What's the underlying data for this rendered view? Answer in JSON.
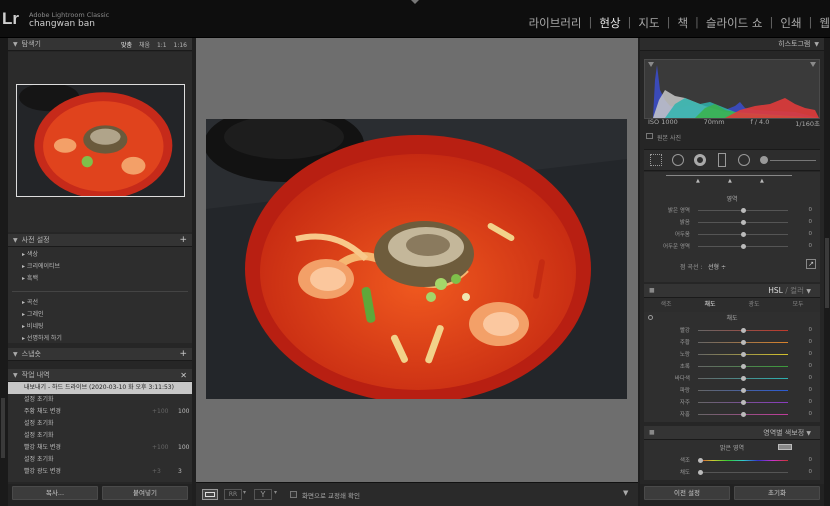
{
  "app": {
    "logo": "Lr",
    "product": "Adobe Lightroom Classic",
    "user": "changwan ban"
  },
  "modules": [
    {
      "label": "라이브러리",
      "active": false
    },
    {
      "label": "현상",
      "active": true
    },
    {
      "label": "지도",
      "active": false
    },
    {
      "label": "책",
      "active": false
    },
    {
      "label": "슬라이드 쇼",
      "active": false
    },
    {
      "label": "인쇄",
      "active": false
    },
    {
      "label": "웹",
      "active": false
    }
  ],
  "navigator": {
    "title": "탐색기",
    "fit": "맞춤",
    "fill": "채움",
    "z1": "1:1",
    "z2": "1:16"
  },
  "presets": {
    "title": "사전 설정",
    "items": [
      "색상",
      "크리에이티브",
      "흑백",
      "곡선",
      "그레인",
      "비네팅",
      "선명하게 하기"
    ]
  },
  "snapshots": {
    "title": "스냅숏"
  },
  "history": {
    "title": "작업 내역",
    "items": [
      {
        "label": "내보내기 - 하드 드라이브 (2020-03-10 화 오후 3:11:53)",
        "a": "",
        "b": "",
        "selected": true
      },
      {
        "label": "설정 초기화",
        "a": "",
        "b": ""
      },
      {
        "label": "주황 채도 변경",
        "a": "+100",
        "b": "100"
      },
      {
        "label": "설정 초기화",
        "a": "",
        "b": ""
      },
      {
        "label": "설정 초기화",
        "a": "",
        "b": ""
      },
      {
        "label": "빨강 채도 변경",
        "a": "+100",
        "b": "100"
      },
      {
        "label": "설정 초기화",
        "a": "",
        "b": ""
      },
      {
        "label": "빨강 광도 변경",
        "a": "+3",
        "b": "3"
      }
    ]
  },
  "left_buttons": {
    "copy": "복사...",
    "paste": "붙여넣기"
  },
  "histogram": {
    "title": "히스토그램",
    "iso": "ISO 1000",
    "focal": "70mm",
    "aperture": "f / 4.0",
    "shutter": "1/160초",
    "original": "원본 사진"
  },
  "tone": {
    "group": "영역",
    "rows": [
      {
        "label": "밝은 영역",
        "value": "0",
        "pos": 0.5
      },
      {
        "label": "밝음",
        "value": "0",
        "pos": 0.5
      },
      {
        "label": "어두움",
        "value": "0",
        "pos": 0.5
      },
      {
        "label": "어두운 영역",
        "value": "0",
        "pos": 0.5
      }
    ],
    "curve_label": "점 곡선 :",
    "curve_value": "선형 ÷"
  },
  "hsl": {
    "title": "HSL",
    "title2": "컬러",
    "tabs": [
      "색조",
      "채도",
      "광도",
      "모두"
    ],
    "active_tab": "채도",
    "group": "채도",
    "rows": [
      {
        "label": "빨강",
        "value": "0",
        "color": "#c0392b"
      },
      {
        "label": "주황",
        "value": "0",
        "color": "#d9822b"
      },
      {
        "label": "노랑",
        "value": "0",
        "color": "#d4c22b"
      },
      {
        "label": "초록",
        "value": "0",
        "color": "#3b9b3b"
      },
      {
        "label": "바다색",
        "value": "0",
        "color": "#2bb0b0"
      },
      {
        "label": "파랑",
        "value": "0",
        "color": "#2b5bd4"
      },
      {
        "label": "자주",
        "value": "0",
        "color": "#8a3bc0"
      },
      {
        "label": "자홍",
        "value": "0",
        "color": "#c03b9b"
      }
    ]
  },
  "split_toning": {
    "title": "영역별 색보정",
    "group": "밝은 영역",
    "rows": [
      {
        "label": "색조",
        "value": "0"
      },
      {
        "label": "채도",
        "value": "0"
      }
    ]
  },
  "right_buttons": {
    "prev": "이전 설정",
    "reset": "초기화"
  },
  "toolbar": {
    "softproof": "화면으로 교정쇄 확인"
  }
}
